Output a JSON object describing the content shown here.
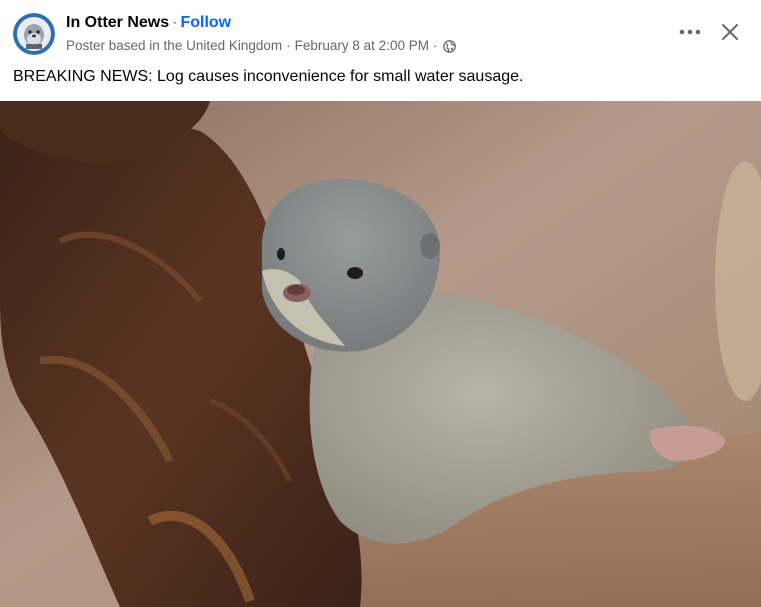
{
  "post": {
    "page_name": "In Otter News",
    "separator": "·",
    "follow_label": "Follow",
    "meta": {
      "location_text": "Poster based in the United Kingdom",
      "timestamp": "February 8 at 2:00 PM",
      "privacy_icon": "globe-icon"
    },
    "caption": "BREAKING NEWS: Log causes inconvenience for small water sausage.",
    "actions": {
      "more_icon": "more-options-icon",
      "close_icon": "close-icon"
    },
    "photo": {
      "subject": "otter-pup-resting-on-log-photo"
    }
  },
  "colors": {
    "link_blue": "#0866ff",
    "secondary_text": "#65676b",
    "primary_text": "#050505"
  }
}
